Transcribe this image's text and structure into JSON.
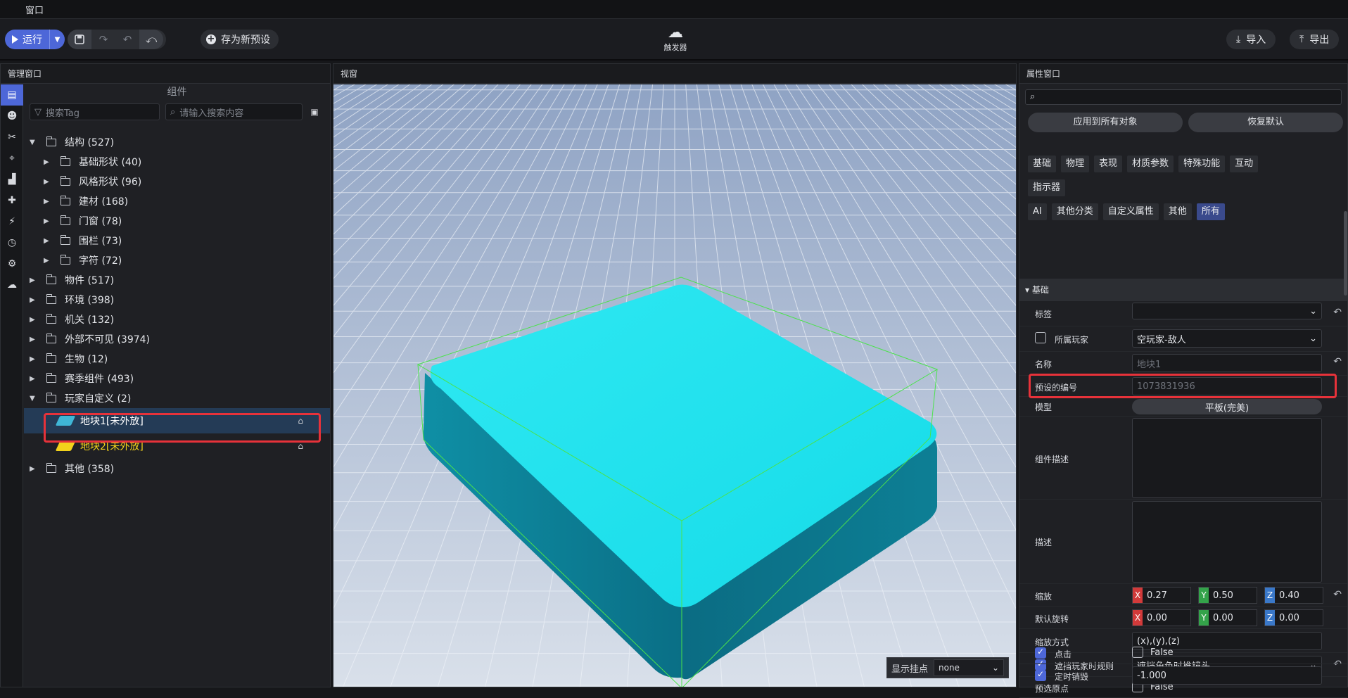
{
  "menu": {
    "window": "窗口"
  },
  "toolbar": {
    "run_label": "运行",
    "save_preset_label": "存为新预设",
    "trigger_label": "触发器",
    "import_label": "导入",
    "export_label": "导出"
  },
  "left_panel": {
    "title": "管理窗口",
    "section_title": "组件",
    "tag_search_placeholder": "搜索Tag",
    "keyword_search_placeholder": "请输入搜索内容",
    "tree": [
      {
        "label": "结构 (527)",
        "level": 0,
        "expanded": true
      },
      {
        "label": "基础形状 (40)",
        "level": 1,
        "expanded": false
      },
      {
        "label": "风格形状 (96)",
        "level": 1,
        "expanded": false
      },
      {
        "label": "建材 (168)",
        "level": 1,
        "expanded": false
      },
      {
        "label": "门窗 (78)",
        "level": 1,
        "expanded": false
      },
      {
        "label": "围栏 (73)",
        "level": 1,
        "expanded": false
      },
      {
        "label": "字符 (72)",
        "level": 1,
        "expanded": false
      },
      {
        "label": "物件 (517)",
        "level": 0,
        "expanded": false
      },
      {
        "label": "环境 (398)",
        "level": 0,
        "expanded": false
      },
      {
        "label": "机关 (132)",
        "level": 0,
        "expanded": false
      },
      {
        "label": "外部不可见 (3974)",
        "level": 0,
        "expanded": false
      },
      {
        "label": "生物 (12)",
        "level": 0,
        "expanded": false
      },
      {
        "label": "赛季组件 (493)",
        "level": 0,
        "expanded": false
      },
      {
        "label": "玩家自定义 (2)",
        "level": 0,
        "expanded": true
      }
    ],
    "custom_items": [
      {
        "label": "地块1[未外放]",
        "color": "#ffffff",
        "icon_color": "#3fb6d6",
        "selected": true
      },
      {
        "label": "地块2[未外放]",
        "color": "#f2d21b",
        "icon_color": "#f2d21b",
        "selected": false
      }
    ],
    "tree_tail": {
      "label": "其他 (358)"
    }
  },
  "viewport": {
    "title": "视窗",
    "anchor_label": "显示挂点",
    "anchor_value": "none",
    "block_color": "#1fe4ee"
  },
  "properties": {
    "title": "属性窗口",
    "apply_all_label": "应用到所有对象",
    "reset_label": "恢复默认",
    "categories": [
      "基础",
      "物理",
      "表现",
      "材质参数",
      "特殊功能",
      "互动",
      "指示器",
      "AI",
      "其他分类",
      "自定义属性",
      "其他",
      "所有"
    ],
    "active_category": "所有",
    "section": "基础",
    "rows": {
      "tag_label": "标签",
      "owner_label": "所属玩家",
      "owner_value": "空玩家-敌人",
      "name_label": "名称",
      "name_value": "地块1",
      "preset_id_label": "预设的编号",
      "preset_id_value": "1073831936",
      "model_label": "模型",
      "model_value": "平板(完美)",
      "component_desc_label": "组件描述",
      "desc_label": "描述",
      "scale_label": "缩放",
      "scale": {
        "x": "0.27",
        "y": "0.50",
        "z": "0.40"
      },
      "rotation_label": "默认旋转",
      "rotation": {
        "x": "0.00",
        "y": "0.00",
        "z": "0.00"
      },
      "scale_mode_label": "缩放方式",
      "scale_mode_value": "(x),(y),(z)",
      "block_rule_label": "遮挡玩家时规则",
      "block_rule_value": "遮挡角色时推镜头",
      "pick_origin_label": "预选原点",
      "pick_origin_value": "False",
      "click_label": "点击",
      "click_value": "False",
      "timed_destroy_label": "定时销毁",
      "timed_destroy_value": "-1.000"
    }
  }
}
